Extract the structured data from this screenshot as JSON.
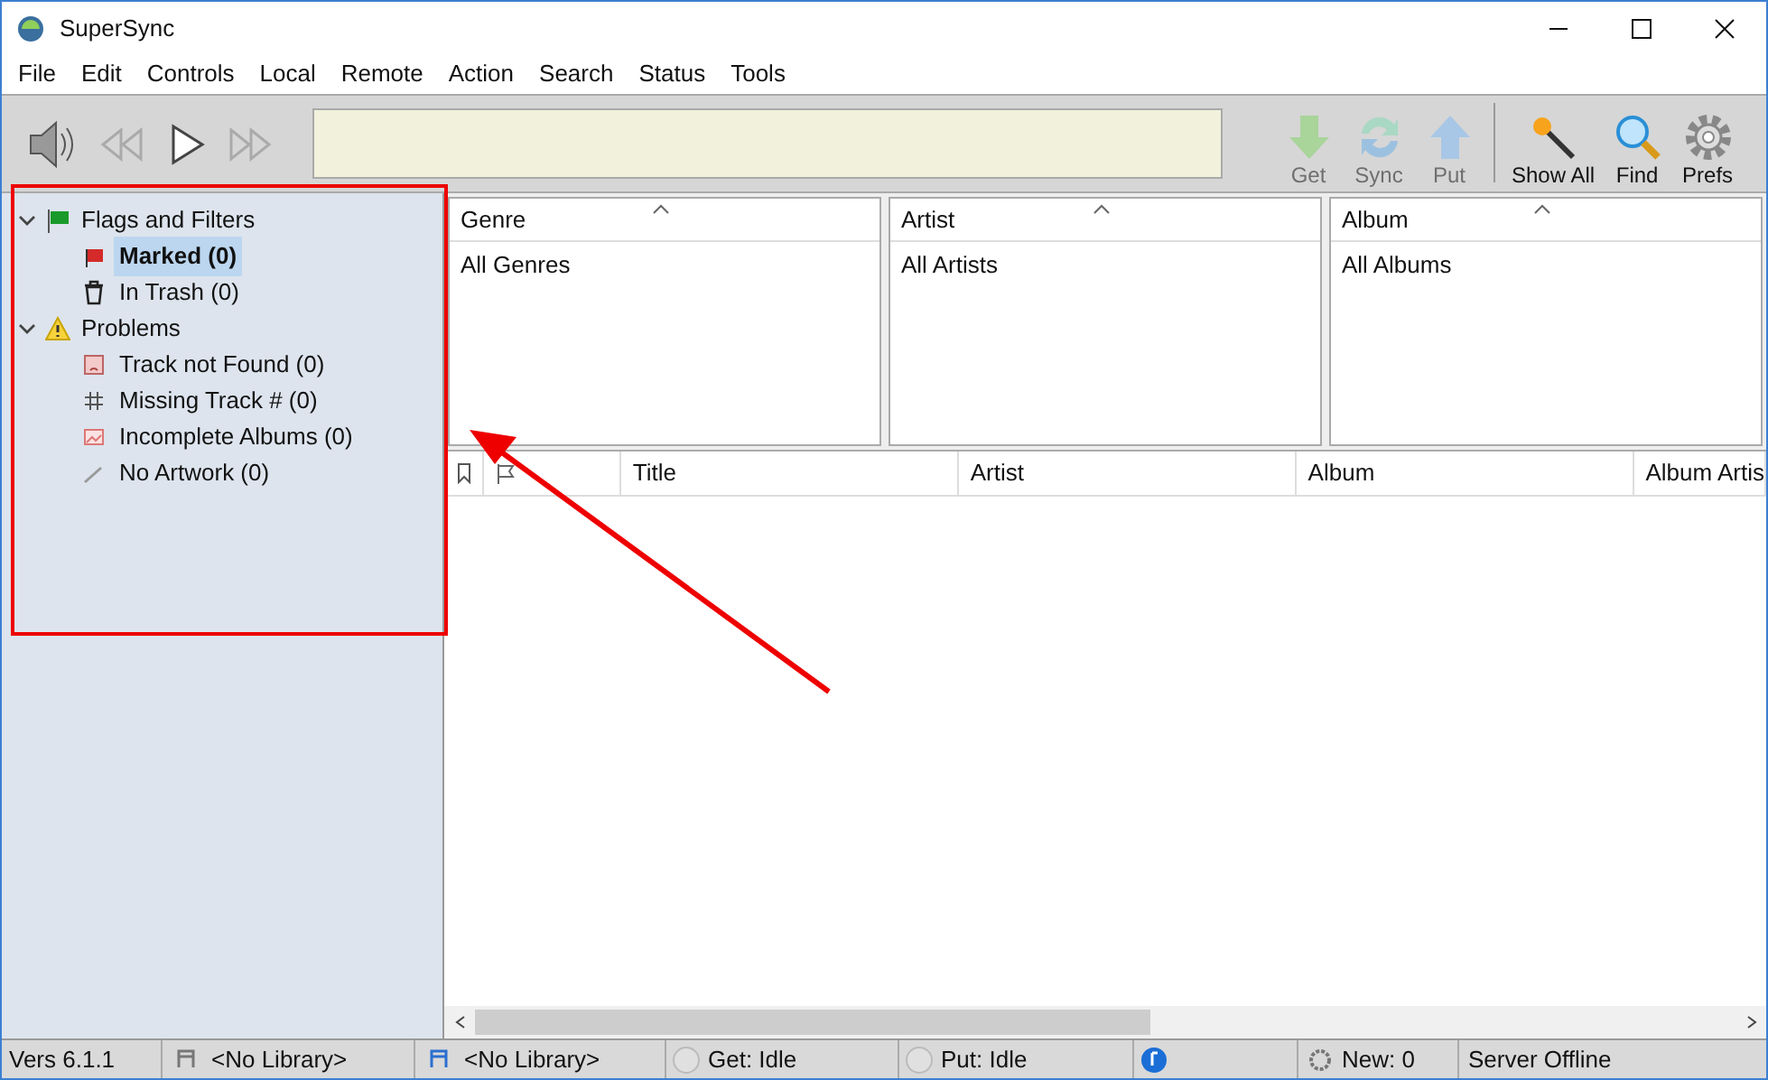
{
  "window": {
    "title": "SuperSync"
  },
  "menu": [
    "File",
    "Edit",
    "Controls",
    "Local",
    "Remote",
    "Action",
    "Search",
    "Status",
    "Tools"
  ],
  "toolbar": [
    {
      "label": "Get",
      "disabled": true
    },
    {
      "label": "Sync",
      "disabled": true
    },
    {
      "label": "Put",
      "disabled": true
    },
    {
      "label": "Show All",
      "disabled": false
    },
    {
      "label": "Find",
      "disabled": false
    },
    {
      "label": "Prefs",
      "disabled": false
    }
  ],
  "sidebar": {
    "items": [
      {
        "label": "Flags and Filters",
        "expanded": true,
        "selected": false,
        "children": [
          {
            "label": "Marked (0)",
            "selected": true
          },
          {
            "label": "In Trash (0)",
            "selected": false
          }
        ]
      },
      {
        "label": "Problems",
        "expanded": true,
        "selected": false,
        "children": [
          {
            "label": "Track not Found (0)",
            "selected": false
          },
          {
            "label": "Missing Track # (0)",
            "selected": false
          },
          {
            "label": "Incomplete Albums (0)",
            "selected": false
          },
          {
            "label": "No Artwork (0)",
            "selected": false
          }
        ]
      }
    ]
  },
  "browser": [
    {
      "heading": "Genre",
      "item": "All Genres"
    },
    {
      "heading": "Artist",
      "item": "All Artists"
    },
    {
      "heading": "Album",
      "item": "All Albums"
    }
  ],
  "table": {
    "columns": [
      "Title",
      "Artist",
      "Album",
      "Album Artis"
    ]
  },
  "status_bar": {
    "version": "Vers 6.1.1",
    "local_library": "<No Library>",
    "remote_library": "<No Library>",
    "get": "Get: Idle",
    "put": "Put: Idle",
    "new": "New: 0",
    "server": "Server Offline"
  }
}
